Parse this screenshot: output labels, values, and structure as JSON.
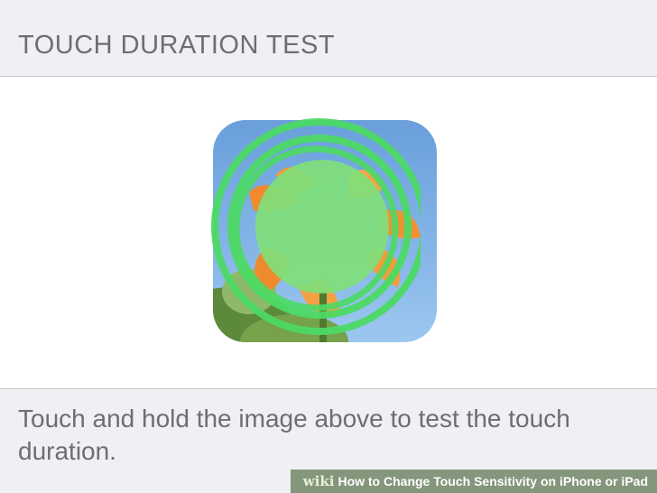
{
  "section_header": {
    "title": "TOUCH DURATION TEST"
  },
  "test_area": {
    "image_icon": "flower-photo",
    "touch_indicator_icon": "touch-rings-icon",
    "touch_color": "#4cd964"
  },
  "footer": {
    "description": "Touch and hold the image above to test the touch duration."
  },
  "watermark": {
    "logo": "wiki",
    "text": "How to Change Touch Sensitivity on iPhone or iPad"
  },
  "colors": {
    "background": "#efeff4",
    "header_text": "#6d6d72",
    "separator": "#c8c7cc",
    "touch_green": "#4cd964"
  }
}
